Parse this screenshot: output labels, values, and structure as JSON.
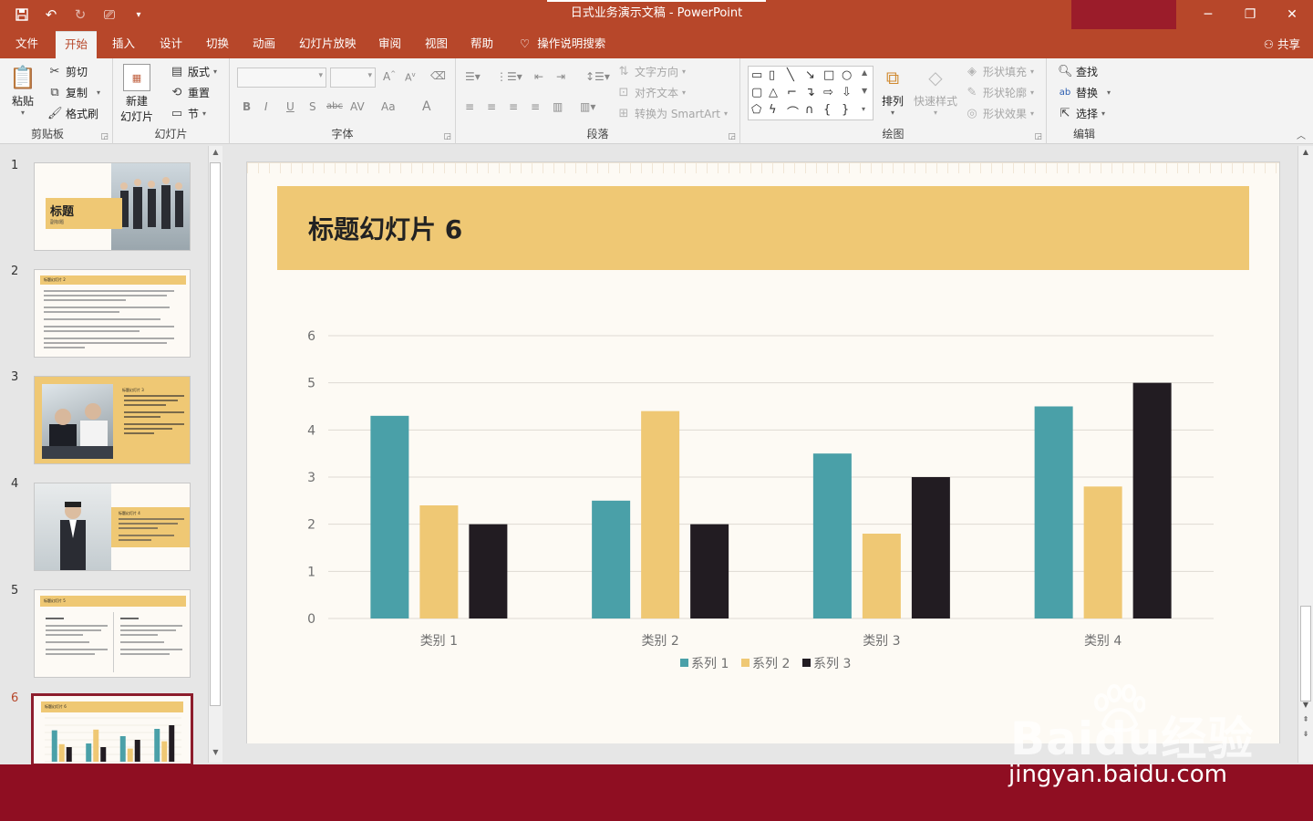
{
  "window": {
    "title": "日式业务演示文稿 - PowerPoint",
    "min_icon": "minimize-icon",
    "restore_icon": "restore-icon",
    "close_icon": "close-icon"
  },
  "tabs": [
    {
      "label": "文件"
    },
    {
      "label": "开始"
    },
    {
      "label": "插入"
    },
    {
      "label": "设计"
    },
    {
      "label": "切换"
    },
    {
      "label": "动画"
    },
    {
      "label": "幻灯片放映"
    },
    {
      "label": "审阅"
    },
    {
      "label": "视图"
    },
    {
      "label": "帮助"
    },
    {
      "label": "操作说明搜索"
    }
  ],
  "share_label": "共享",
  "ribbon": {
    "clipboard": {
      "label": "剪贴板",
      "paste": "粘贴",
      "cut": "剪切",
      "copy": "复制",
      "format_painter": "格式刷"
    },
    "slides": {
      "label": "幻灯片",
      "new_slide_1": "新建",
      "new_slide_2": "幻灯片",
      "layout": "版式",
      "reset": "重置",
      "section": "节"
    },
    "font": {
      "label": "字体",
      "bold": "B",
      "italic": "I",
      "underline": "U",
      "shadow": "S",
      "strike": "abc",
      "spacing": "AV",
      "case": "Aa",
      "color": "A"
    },
    "paragraph": {
      "label": "段落",
      "text_direction": "文字方向",
      "align_text": "对齐文本",
      "smartart": "转换为 SmartArt"
    },
    "drawing": {
      "label": "绘图",
      "arrange": "排列",
      "quick_styles": "快速样式",
      "shape_fill": "形状填充",
      "shape_outline": "形状轮廓",
      "shape_effects": "形状效果"
    },
    "editing": {
      "label": "编辑",
      "find": "查找",
      "replace": "替换",
      "select": "选择"
    }
  },
  "thumbnails": [
    {
      "num": "1",
      "title": "标题",
      "sub": "副标题"
    },
    {
      "num": "2",
      "title": "标题幻灯片 2"
    },
    {
      "num": "3",
      "title": "标题幻灯片 3"
    },
    {
      "num": "4",
      "title": "标题幻灯片 4"
    },
    {
      "num": "5",
      "title": "标题幻灯片 5"
    },
    {
      "num": "6",
      "title": "标题幻灯片 6"
    }
  ],
  "slide": {
    "title": "标题幻灯片 6"
  },
  "colors": {
    "accent": "#b7472a",
    "series1": "#4aa0a8",
    "series2": "#efc874",
    "series3": "#221c22",
    "title_box": "#efc874"
  },
  "chart_data": {
    "type": "bar",
    "categories": [
      "类别 1",
      "类别 2",
      "类别 3",
      "类别 4"
    ],
    "series": [
      {
        "name": "系列 1",
        "values": [
          4.3,
          2.5,
          3.5,
          4.5
        ]
      },
      {
        "name": "系列 2",
        "values": [
          2.4,
          4.4,
          1.8,
          2.8
        ]
      },
      {
        "name": "系列 3",
        "values": [
          2,
          2,
          3,
          5
        ]
      }
    ],
    "ylim": [
      0,
      6
    ],
    "yticks": [
      "0",
      "1",
      "2",
      "3",
      "4",
      "5",
      "6"
    ],
    "grid": true,
    "legend": "bottom"
  },
  "watermark": {
    "brand": "Baidu经验",
    "url": "jingyan.baidu.com"
  }
}
